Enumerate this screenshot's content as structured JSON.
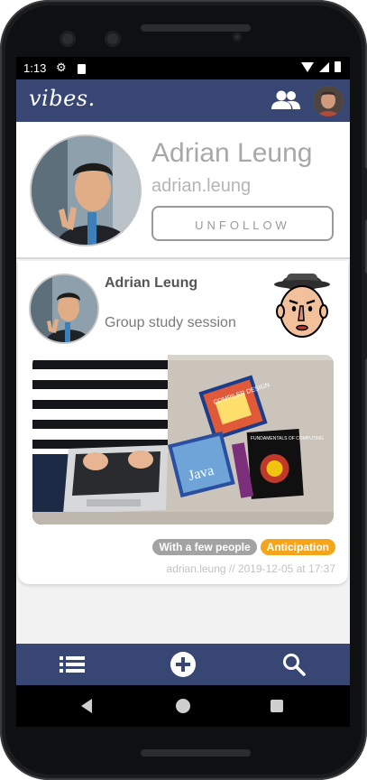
{
  "status_bar": {
    "time": "1:13"
  },
  "app": {
    "logo": "vibes."
  },
  "profile": {
    "name": "Adrian Leung",
    "handle": "adrian.leung",
    "unfollow_label": "UNFOLLOW"
  },
  "post": {
    "author": "Adrian Leung",
    "title": "Group study session",
    "tags": [
      "With a few people",
      "Anticipation"
    ],
    "meta": "adrian.leung  //  2019-12-05 at 17:37",
    "image_text": {
      "book1": "COMPILER DESIGN",
      "book2": "Java",
      "book3": "FUNDAMENTALS OF COMPUTING"
    }
  },
  "bottom_nav": {
    "items": [
      {
        "icon": "list-icon"
      },
      {
        "icon": "add-circle-icon"
      },
      {
        "icon": "search-icon"
      }
    ]
  },
  "colors": {
    "app_bar": "#384673",
    "tag_grey": "#a3a3a3",
    "tag_orange": "#f4a51c"
  }
}
